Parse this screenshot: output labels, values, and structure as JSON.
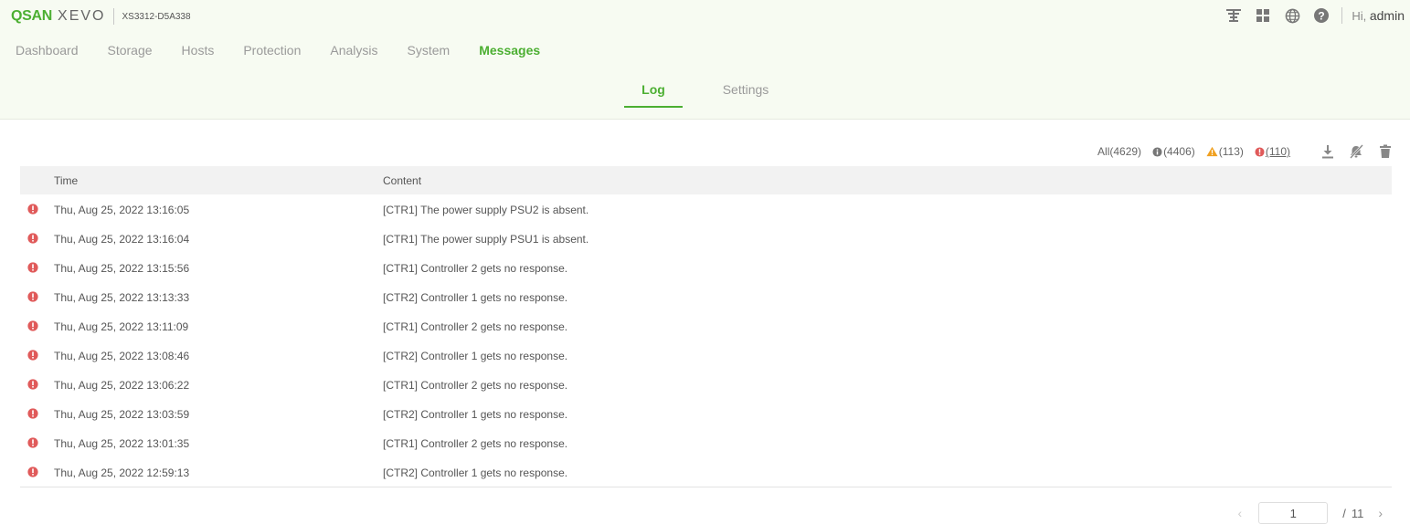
{
  "header": {
    "logo_primary": "QSAN",
    "logo_secondary": "XEVO",
    "model": "XS3312-D5A338",
    "greeting_prefix": "Hi,",
    "username": "admin"
  },
  "top_icons": [
    "network-icon",
    "grid-icon",
    "globe-icon",
    "help-icon"
  ],
  "nav": {
    "items": [
      "Dashboard",
      "Storage",
      "Hosts",
      "Protection",
      "Analysis",
      "System",
      "Messages"
    ],
    "active": "Messages"
  },
  "subtabs": {
    "log": "Log",
    "settings": "Settings",
    "active": "Log"
  },
  "counts": {
    "all": "All(4629)",
    "info": "(4406)",
    "warning": "(113)",
    "error": "(110)"
  },
  "table": {
    "headers": {
      "time": "Time",
      "content": "Content"
    },
    "rows": [
      {
        "severity": "error",
        "time": "Thu, Aug 25, 2022 13:16:05",
        "content": "[CTR1] The power supply PSU2 is absent."
      },
      {
        "severity": "error",
        "time": "Thu, Aug 25, 2022 13:16:04",
        "content": "[CTR1] The power supply PSU1 is absent."
      },
      {
        "severity": "error",
        "time": "Thu, Aug 25, 2022 13:15:56",
        "content": "[CTR1] Controller 2 gets no response."
      },
      {
        "severity": "error",
        "time": "Thu, Aug 25, 2022 13:13:33",
        "content": "[CTR2] Controller 1 gets no response."
      },
      {
        "severity": "error",
        "time": "Thu, Aug 25, 2022 13:11:09",
        "content": "[CTR1] Controller 2 gets no response."
      },
      {
        "severity": "error",
        "time": "Thu, Aug 25, 2022 13:08:46",
        "content": "[CTR2] Controller 1 gets no response."
      },
      {
        "severity": "error",
        "time": "Thu, Aug 25, 2022 13:06:22",
        "content": "[CTR1] Controller 2 gets no response."
      },
      {
        "severity": "error",
        "time": "Thu, Aug 25, 2022 13:03:59",
        "content": "[CTR2] Controller 1 gets no response."
      },
      {
        "severity": "error",
        "time": "Thu, Aug 25, 2022 13:01:35",
        "content": "[CTR1] Controller 2 gets no response."
      },
      {
        "severity": "error",
        "time": "Thu, Aug 25, 2022 12:59:13",
        "content": "[CTR2] Controller 1 gets no response."
      }
    ]
  },
  "pagination": {
    "current": "1",
    "separator": "/",
    "total": "11",
    "prev": "‹",
    "next": "›"
  },
  "colors": {
    "accent": "#4caf32",
    "error": "#e05a5a",
    "warning": "#f0a020",
    "info": "#777777",
    "header_bg": "#f7fbf2"
  }
}
